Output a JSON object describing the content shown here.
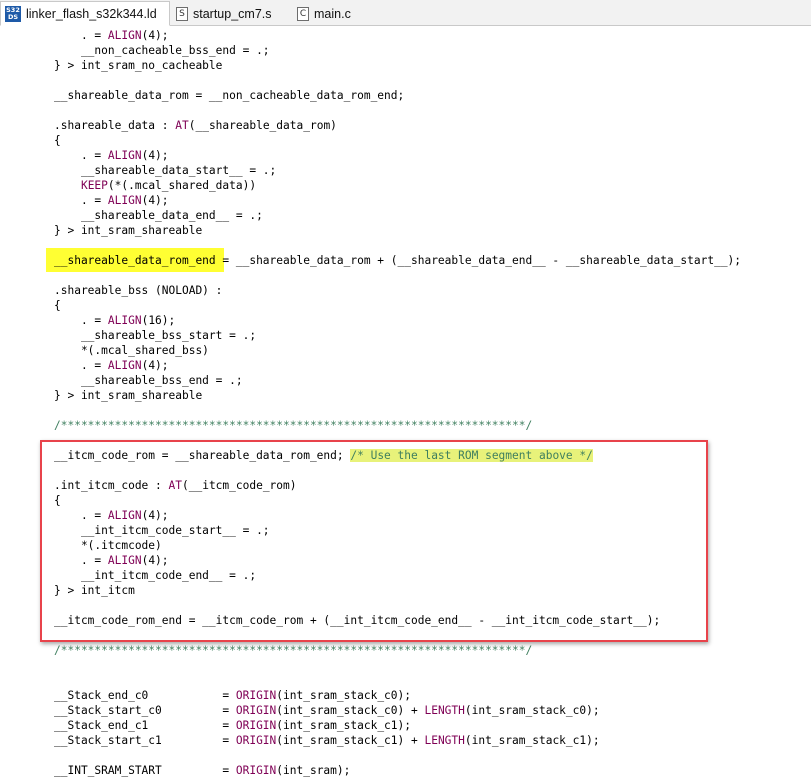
{
  "tabs": [
    {
      "label": "linker_flash_s32k344.ld",
      "icon": "S32\nDS",
      "active": true
    },
    {
      "label": "startup_cm7.s",
      "icon": "S",
      "active": false
    },
    {
      "label": "main.c",
      "icon": "C",
      "active": false
    }
  ],
  "editor": {
    "lines": [
      [
        {
          "t": "    . = "
        },
        {
          "t": "ALIGN",
          "c": "kw"
        },
        {
          "t": "(4);"
        }
      ],
      [
        {
          "t": "    __non_cacheable_bss_end = .;"
        }
      ],
      [
        {
          "t": "} > int_sram_no_cacheable"
        }
      ],
      [
        {
          "t": ""
        }
      ],
      [
        {
          "t": "__shareable_data_rom = __non_cacheable_data_rom_end;"
        }
      ],
      [
        {
          "t": ""
        }
      ],
      [
        {
          "t": ".shareable_data : "
        },
        {
          "t": "AT",
          "c": "kw"
        },
        {
          "t": "(__shareable_data_rom)"
        }
      ],
      [
        {
          "t": "{"
        }
      ],
      [
        {
          "t": "    . = "
        },
        {
          "t": "ALIGN",
          "c": "kw"
        },
        {
          "t": "(4);"
        }
      ],
      [
        {
          "t": "    __shareable_data_start__ = .;"
        }
      ],
      [
        {
          "t": "    "
        },
        {
          "t": "KEEP",
          "c": "kw"
        },
        {
          "t": "(*(.mcal_shared_data))"
        }
      ],
      [
        {
          "t": "    . = "
        },
        {
          "t": "ALIGN",
          "c": "kw"
        },
        {
          "t": "(4);"
        }
      ],
      [
        {
          "t": "    __shareable_data_end__ = .;"
        }
      ],
      [
        {
          "t": "} > int_sram_shareable"
        }
      ],
      [
        {
          "t": ""
        }
      ],
      [
        {
          "t": "__shareable_data_rom_end",
          "c": "hl"
        },
        {
          "t": " = __shareable_data_rom + (__shareable_data_end__ - __shareable_data_start__);"
        }
      ],
      [
        {
          "t": ""
        }
      ],
      [
        {
          "t": ".shareable_bss (NOLOAD) :"
        }
      ],
      [
        {
          "t": "{"
        }
      ],
      [
        {
          "t": "    . = "
        },
        {
          "t": "ALIGN",
          "c": "kw"
        },
        {
          "t": "(16);"
        }
      ],
      [
        {
          "t": "    __shareable_bss_start = .;"
        }
      ],
      [
        {
          "t": "    *(.mcal_shared_bss)"
        }
      ],
      [
        {
          "t": "    . = "
        },
        {
          "t": "ALIGN",
          "c": "kw"
        },
        {
          "t": "(4);"
        }
      ],
      [
        {
          "t": "    __shareable_bss_end = .;"
        }
      ],
      [
        {
          "t": "} > int_sram_shareable"
        }
      ],
      [
        {
          "t": ""
        }
      ],
      [
        {
          "t": "/*********************************************************************/",
          "c": "cm"
        }
      ],
      [
        {
          "t": ""
        }
      ],
      [
        {
          "t": "__itcm_code_rom = __shareable_data_rom_end; "
        },
        {
          "t": "/* Use the last ROM segment above */",
          "c": "cm hl-soft"
        }
      ],
      [
        {
          "t": ""
        }
      ],
      [
        {
          "t": ".int_itcm_code : "
        },
        {
          "t": "AT",
          "c": "kw"
        },
        {
          "t": "(__itcm_code_rom)"
        }
      ],
      [
        {
          "t": "{"
        }
      ],
      [
        {
          "t": "    . = "
        },
        {
          "t": "ALIGN",
          "c": "kw"
        },
        {
          "t": "(4);"
        }
      ],
      [
        {
          "t": "    __int_itcm_code_start__ = .;"
        }
      ],
      [
        {
          "t": "    *(.itcmcode)"
        }
      ],
      [
        {
          "t": "    . = "
        },
        {
          "t": "ALIGN",
          "c": "kw"
        },
        {
          "t": "(4);"
        }
      ],
      [
        {
          "t": "    __int_itcm_code_end__ = .;"
        }
      ],
      [
        {
          "t": "} > int_itcm"
        }
      ],
      [
        {
          "t": ""
        }
      ],
      [
        {
          "t": "__itcm_code_rom_end = __itcm_code_rom + (__int_itcm_code_end__ - __int_itcm_code_start__);"
        }
      ],
      [
        {
          "t": ""
        }
      ],
      [
        {
          "t": "/*********************************************************************/",
          "c": "cm"
        }
      ],
      [
        {
          "t": ""
        }
      ],
      [
        {
          "t": ""
        }
      ],
      [
        {
          "t": "__Stack_end_c0           = "
        },
        {
          "t": "ORIGIN",
          "c": "kw"
        },
        {
          "t": "(int_sram_stack_c0);"
        }
      ],
      [
        {
          "t": "__Stack_start_c0         = "
        },
        {
          "t": "ORIGIN",
          "c": "kw"
        },
        {
          "t": "(int_sram_stack_c0) + "
        },
        {
          "t": "LENGTH",
          "c": "kw"
        },
        {
          "t": "(int_sram_stack_c0);"
        }
      ],
      [
        {
          "t": "__Stack_end_c1           = "
        },
        {
          "t": "ORIGIN",
          "c": "kw"
        },
        {
          "t": "(int_sram_stack_c1);"
        }
      ],
      [
        {
          "t": "__Stack_start_c1         = "
        },
        {
          "t": "ORIGIN",
          "c": "kw"
        },
        {
          "t": "(int_sram_stack_c1) + "
        },
        {
          "t": "LENGTH",
          "c": "kw"
        },
        {
          "t": "(int_sram_stack_c1);"
        }
      ],
      [
        {
          "t": ""
        }
      ],
      [
        {
          "t": "__INT_SRAM_START         = "
        },
        {
          "t": "ORIGIN",
          "c": "kw"
        },
        {
          "t": "(int_sram);"
        }
      ]
    ]
  },
  "colors": {
    "keyword": "#7f0055",
    "comment": "#3f7f5f",
    "highlight": "#ffff33",
    "box": "#e8434b"
  }
}
